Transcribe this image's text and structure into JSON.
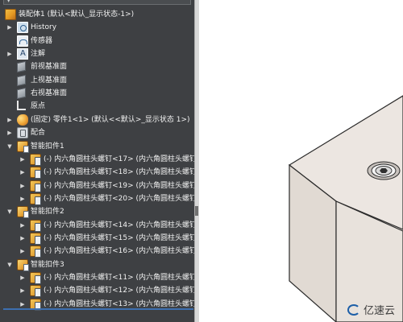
{
  "tree": {
    "rows": [
      {
        "label": "装配体1  (默认<默认_显示状态-1>)",
        "icon": "assembly-icon",
        "arrow": "",
        "indent": 0
      },
      {
        "label": "History",
        "icon": "history-icon",
        "arrow": "▶",
        "indent": 1
      },
      {
        "label": "传感器",
        "icon": "sensor-icon",
        "arrow": "",
        "indent": 1
      },
      {
        "label": "注解",
        "icon": "annotation-icon",
        "arrow": "▶",
        "indent": 1
      },
      {
        "label": "前视基准面",
        "icon": "plane-icon",
        "arrow": "",
        "indent": 1
      },
      {
        "label": "上视基准面",
        "icon": "plane-icon",
        "arrow": "",
        "indent": 1
      },
      {
        "label": "右视基准面",
        "icon": "plane-icon",
        "arrow": "",
        "indent": 1
      },
      {
        "label": "原点",
        "icon": "origin-icon",
        "arrow": "",
        "indent": 1
      },
      {
        "label": "(固定) 零件1<1> (默认<<默认>_显示状态 1>)",
        "icon": "part-icon",
        "arrow": "▶",
        "indent": 1
      },
      {
        "label": "配合",
        "icon": "mate-icon",
        "arrow": "▶",
        "indent": 1
      },
      {
        "label": "智能扣件1",
        "icon": "smart-fastener-icon",
        "arrow": "▼",
        "indent": 1
      },
      {
        "label": "(-) 内六角圆柱头螺钉<17> (内六角圆柱头螺钉",
        "icon": "bolt-icon",
        "arrow": "▶",
        "indent": 2
      },
      {
        "label": "(-) 内六角圆柱头螺钉<18> (内六角圆柱头螺钉",
        "icon": "bolt-icon",
        "arrow": "▶",
        "indent": 2
      },
      {
        "label": "(-) 内六角圆柱头螺钉<19> (内六角圆柱头螺钉",
        "icon": "bolt-icon",
        "arrow": "▶",
        "indent": 2
      },
      {
        "label": "(-) 内六角圆柱头螺钉<20> (内六角圆柱头螺钉",
        "icon": "bolt-icon",
        "arrow": "▶",
        "indent": 2
      },
      {
        "label": "智能扣件2",
        "icon": "smart-fastener-icon",
        "arrow": "▼",
        "indent": 1
      },
      {
        "label": "(-) 内六角圆柱头螺钉<14> (内六角圆柱头螺钉",
        "icon": "bolt-icon",
        "arrow": "▶",
        "indent": 2
      },
      {
        "label": "(-) 内六角圆柱头螺钉<15> (内六角圆柱头螺钉",
        "icon": "bolt-icon",
        "arrow": "▶",
        "indent": 2
      },
      {
        "label": "(-) 内六角圆柱头螺钉<16> (内六角圆柱头螺钉",
        "icon": "bolt-icon",
        "arrow": "▶",
        "indent": 2
      },
      {
        "label": "智能扣件3",
        "icon": "smart-fastener-icon",
        "arrow": "▼",
        "indent": 1
      },
      {
        "label": "(-) 内六角圆柱头螺钉<11> (内六角圆柱头螺钉",
        "icon": "bolt-icon",
        "arrow": "▶",
        "indent": 2
      },
      {
        "label": "(-) 内六角圆柱头螺钉<12> (内六角圆柱头螺钉",
        "icon": "bolt-icon",
        "arrow": "▶",
        "indent": 2
      },
      {
        "label": "(-) 内六角圆柱头螺钉<13> (内六角圆柱头螺钉",
        "icon": "bolt-icon",
        "arrow": "▶",
        "indent": 2
      }
    ]
  },
  "graphics": {
    "watermark_text": "亿速云",
    "plate_top_color": "#ece6e1",
    "plate_side_color": "#e2dbd5",
    "plate_edge_color": "#2a2a2a"
  },
  "colors": {
    "panel_bg": "#3e4043",
    "text": "#f2f2f2",
    "accent": "#3d6fb0"
  }
}
